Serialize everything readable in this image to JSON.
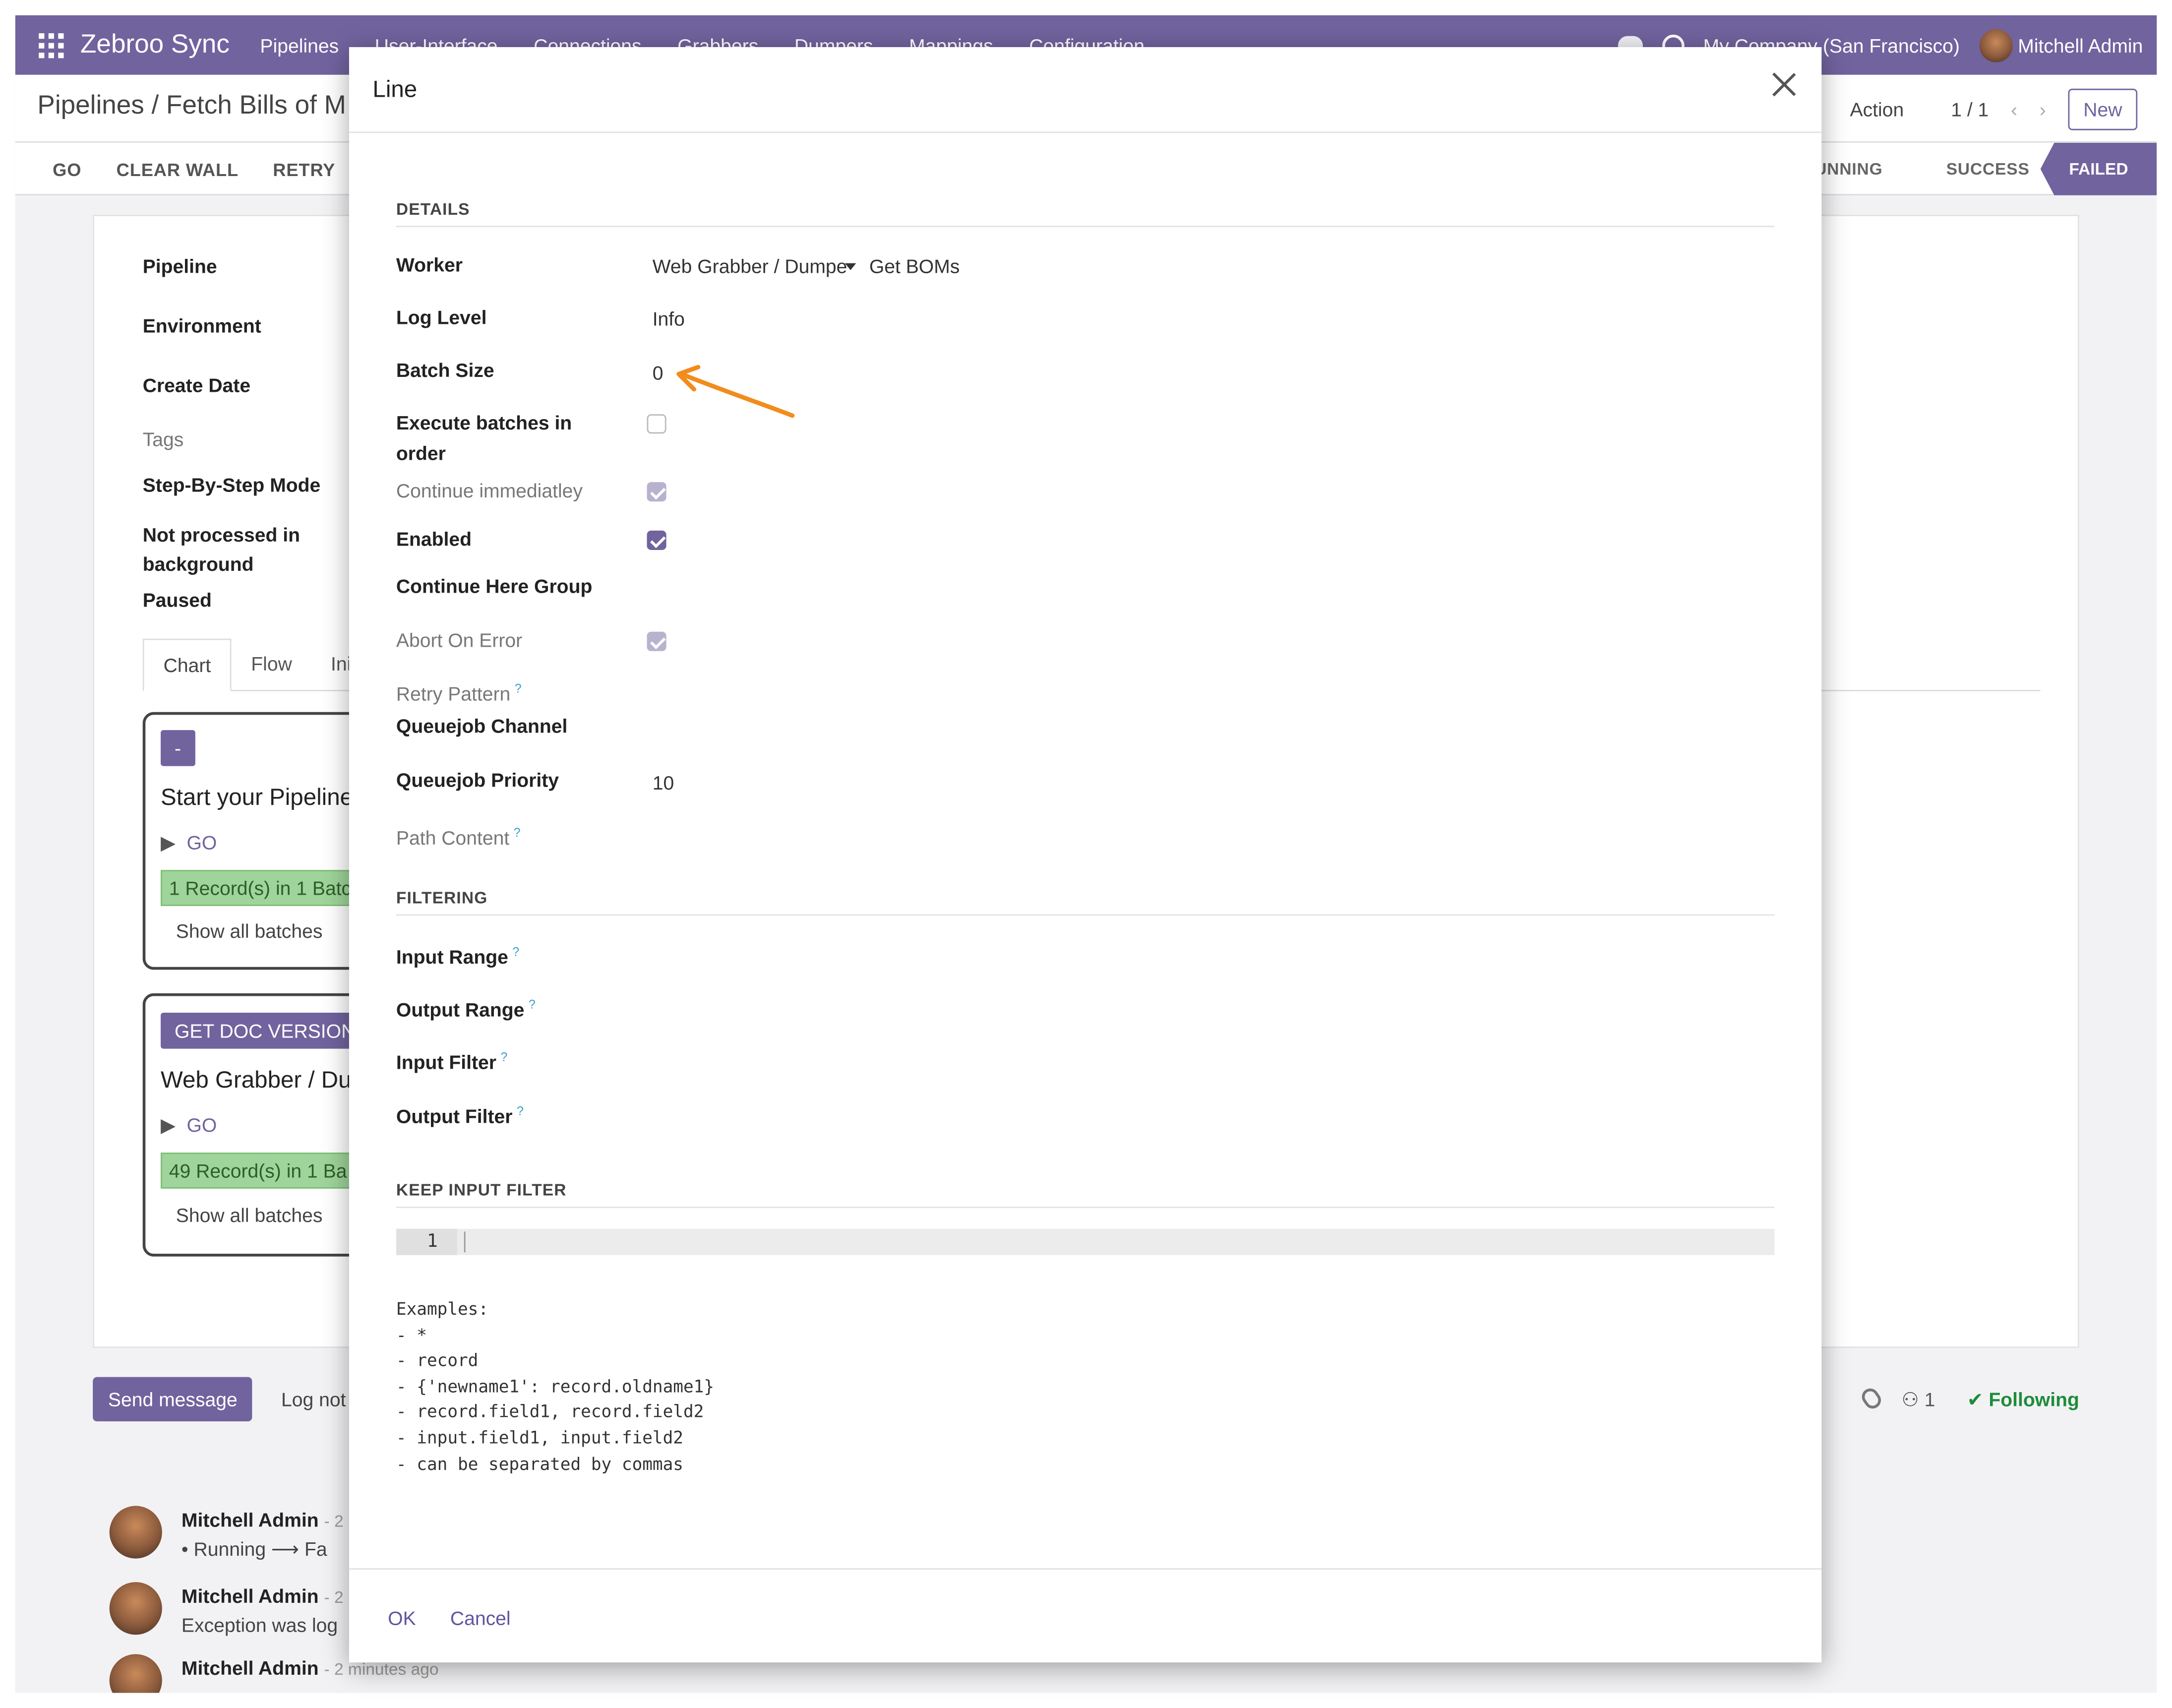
{
  "topbar": {
    "brand": "Zebroo Sync",
    "menu": [
      "Pipelines",
      "User-Interface",
      "Connections",
      "Grabbers",
      "Dumpers",
      "Mappings",
      "Configuration"
    ],
    "company": "My Company (San Francisco)",
    "user": "Mitchell Admin"
  },
  "control_panel": {
    "breadcrumb": "Pipelines / Fetch Bills of M",
    "action": "Action",
    "pager": "1 / 1",
    "new_label": "New"
  },
  "statusbar": {
    "buttons": [
      "GO",
      "CLEAR WALL",
      "RETRY"
    ],
    "stages": [
      "RUNNING",
      "SUCCESS",
      "FAILED"
    ],
    "active_stage": "FAILED"
  },
  "sheet": {
    "labels": [
      "Pipeline",
      "Environment",
      "Create Date",
      "Tags",
      "Step-By-Step Mode",
      "Not processed in background",
      "Paused"
    ],
    "tabs": [
      "Chart",
      "Flow",
      "Ini"
    ],
    "cards": [
      {
        "badge": "-",
        "title": "Start your Pipeline",
        "go": "GO",
        "records": "1 Record(s) in 1 Batc",
        "show": "Show all batches"
      },
      {
        "badge": "GET DOC VERSION",
        "title": "Web Grabber / Du",
        "go": "GO",
        "records": "49 Record(s) in 1 Ba",
        "show": "Show all batches"
      }
    ]
  },
  "chatter": {
    "send_label": "Send message",
    "log_label": "Log not",
    "followers": "1",
    "following_label": "Following",
    "messages": [
      {
        "author": "Mitchell Admin",
        "time": "- 2",
        "body": "•  Running  ⟶ Fa"
      },
      {
        "author": "Mitchell Admin",
        "time": "- 2",
        "body": "Exception was log"
      },
      {
        "author": "Mitchell Admin",
        "time": "- 2 minutes ago",
        "body": ""
      }
    ]
  },
  "modal": {
    "title": "Line",
    "sections": {
      "details": "DETAILS",
      "filtering": "FILTERING",
      "keep_input_filter": "KEEP INPUT FILTER"
    },
    "fields": {
      "worker": {
        "label": "Worker",
        "value": "Web Grabber / Dumpe",
        "value2": "Get BOMs"
      },
      "log_level": {
        "label": "Log Level",
        "value": "Info"
      },
      "batch_size": {
        "label": "Batch Size",
        "value": "0"
      },
      "execute_batches": {
        "label": "Execute batches in order",
        "checked": false
      },
      "continue_immediately": {
        "label": "Continue immediatley",
        "checked": true
      },
      "enabled": {
        "label": "Enabled",
        "checked": true
      },
      "continue_here_group": {
        "label": "Continue Here Group"
      },
      "abort_on_error": {
        "label": "Abort On Error",
        "checked": true
      },
      "retry_pattern": {
        "label": "Retry Pattern",
        "help": "?"
      },
      "queuejob_channel": {
        "label": "Queuejob Channel"
      },
      "queuejob_priority": {
        "label": "Queuejob Priority",
        "value": "10"
      },
      "path_content": {
        "label": "Path Content",
        "help": "?"
      },
      "input_range": {
        "label": "Input Range",
        "help": "?"
      },
      "output_range": {
        "label": "Output Range",
        "help": "?"
      },
      "input_filter": {
        "label": "Input Filter",
        "help": "?"
      },
      "output_filter": {
        "label": "Output Filter",
        "help": "?"
      }
    },
    "editor_line": "1",
    "examples": "Examples:\n- *\n- record\n- {'newname1': record.oldname1}\n- record.field1, record.field2\n- input.field1, input.field2\n- can be separated by commas",
    "ok_label": "OK",
    "cancel_label": "Cancel"
  },
  "colors": {
    "brand": "#71639e",
    "annotation_arrow": "#f28c1c",
    "success": "#1e8c3a"
  }
}
